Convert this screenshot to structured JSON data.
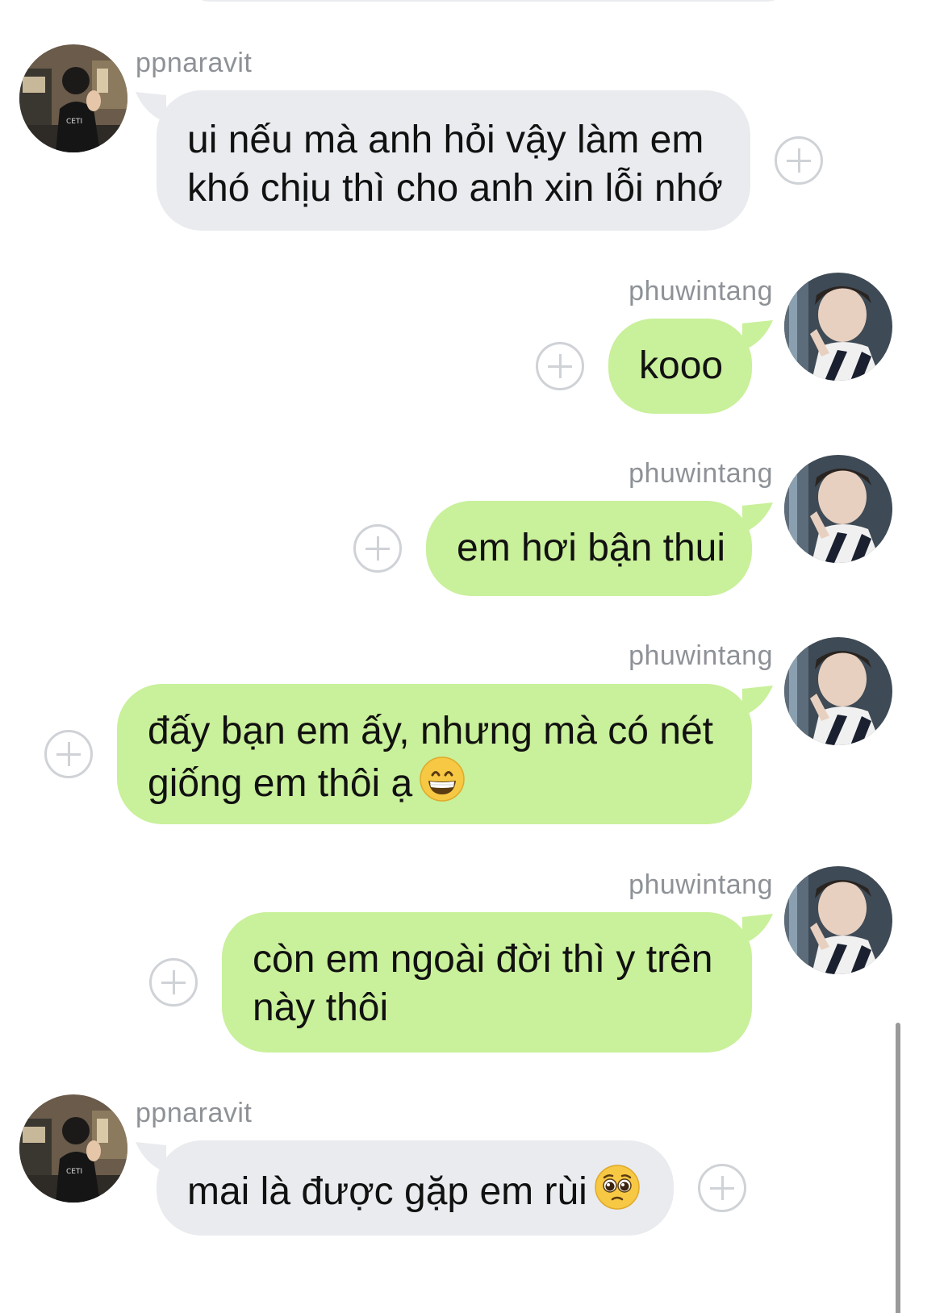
{
  "colors": {
    "incoming_bubble": "#e9ebee",
    "outgoing_bubble": "#c9f09a",
    "sender_name": "#8e9297",
    "react_button": "#cfd2d6"
  },
  "messages": [
    {
      "sender": "ppnaravit",
      "direction": "incoming",
      "text": "ui nếu mà anh hỏi vậy làm em\nkhó chịu thì cho anh xin lỗi nhớ",
      "emoji": null
    },
    {
      "sender": "phuwintang",
      "direction": "outgoing",
      "text": "kooo",
      "emoji": null
    },
    {
      "sender": "phuwintang",
      "direction": "outgoing",
      "text": "em hơi bận thui",
      "emoji": null
    },
    {
      "sender": "phuwintang",
      "direction": "outgoing",
      "text": "đấy bạn em ấy, nhưng mà có nét\ngiống em thôi ạ",
      "emoji": "grinning-face-emoji"
    },
    {
      "sender": "phuwintang",
      "direction": "outgoing",
      "text": "còn em ngoài đời thì y trên\nnày thôi",
      "emoji": null
    },
    {
      "sender": "ppnaravit",
      "direction": "incoming",
      "text": "mai là được gặp em rùi",
      "emoji": "pleading-face-emoji"
    }
  ],
  "icons": {
    "react": "add-reaction-icon",
    "avatar_ppnaravit": "avatar-photo",
    "avatar_phuwintang": "avatar-photo"
  }
}
